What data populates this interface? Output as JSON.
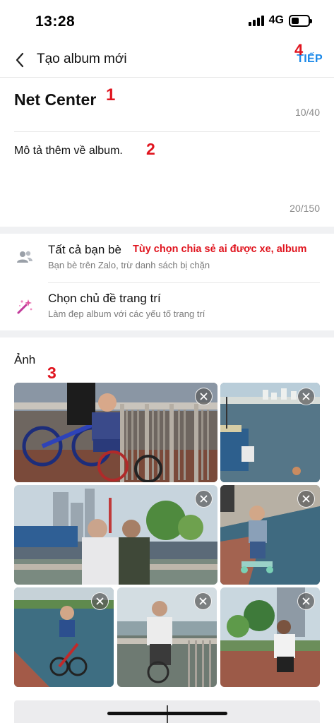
{
  "status_bar": {
    "time": "13:28",
    "network": "4G"
  },
  "header": {
    "title": "Tạo album mới",
    "next_label": "TIẾP"
  },
  "album": {
    "name": "Net Center",
    "name_count": "10/40",
    "description_placeholder": "Mô tả thêm về album.",
    "description_count": "20/150"
  },
  "options": {
    "share": {
      "title": "Tất cả bạn bè",
      "subtitle": "Bạn bè trên Zalo, trừ danh sách bị chặn",
      "note": "Tùy chọn chia sẻ ai được xe, album"
    },
    "theme": {
      "title": "Chọn chủ đề trang trí",
      "subtitle": "Làm đẹp album với các yếu tố trang trí"
    }
  },
  "photos": {
    "label": "Ảnh"
  },
  "annotations": {
    "a1": "1",
    "a2": "2",
    "a3": "3",
    "a4": "4"
  },
  "colors": {
    "accent": "#1a88e8",
    "annotation": "#e0141e"
  }
}
